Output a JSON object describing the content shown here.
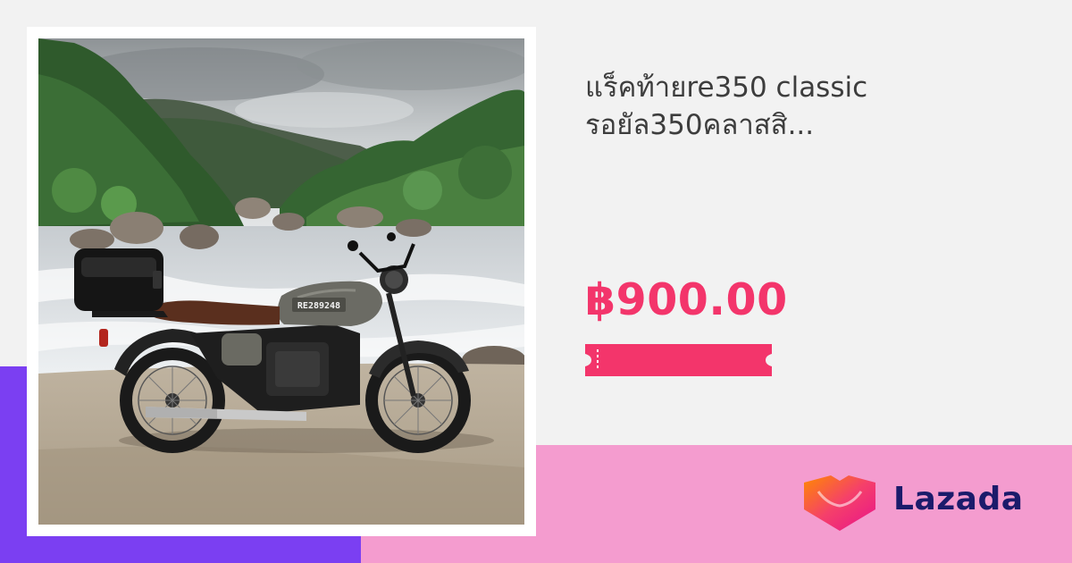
{
  "product": {
    "title_line1": "แร็คท้ายre350 classic",
    "title_line2": "รอยัล350คลาสสิ...",
    "price": "฿900.00",
    "plate_text": "RE289248"
  },
  "brand": {
    "name": "Lazada"
  },
  "colors": {
    "price": "#f3356b",
    "voucher": "#f3356b",
    "purple_band": "#7b3ff2",
    "pink_band": "#f49ccf",
    "logo_text": "#1b1b6b"
  },
  "icons": {
    "voucher": "ticket-icon",
    "brand_mark": "lazada-heart-icon"
  }
}
